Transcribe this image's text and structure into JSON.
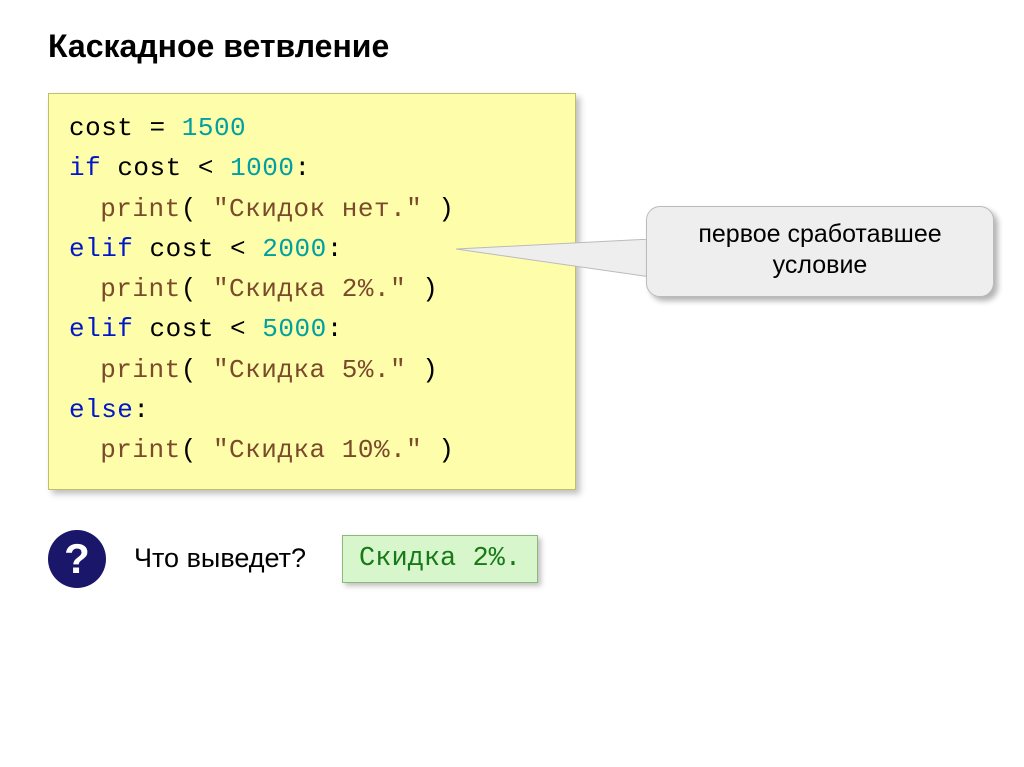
{
  "title": "Каскадное ветвление",
  "code": {
    "var": "cost",
    "eq": " = ",
    "v1500": "1500",
    "if": "if",
    "lt": " < ",
    "colon": ":",
    "v1000": "1000",
    "p": "print",
    "open": "( ",
    "close": " )",
    "s_no": "\"Скидок нет.\"",
    "elif": "elif",
    "v2000": "2000",
    "s_2": "\"Скидка 2%.\"",
    "v5000": "5000",
    "s_5": "\"Скидка 5%.\"",
    "else": "else",
    "s_10": "\"Скидка 10%.\""
  },
  "callout": "первое сработавшее условие",
  "qmark": "?",
  "question": "Что выведет?",
  "answer": "Скидка 2%."
}
